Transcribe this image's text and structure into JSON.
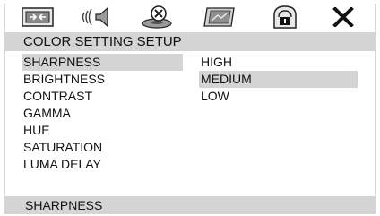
{
  "toolbar": {
    "icons": [
      "general-setup-icon",
      "audio-setup-icon",
      "dolby-digital-setup-icon",
      "video-setup-icon",
      "preference-lock-icon",
      "exit-icon"
    ]
  },
  "header": {
    "title": "COLOR SETTING SETUP"
  },
  "settings": {
    "items": [
      {
        "label": "SHARPNESS",
        "selected": true
      },
      {
        "label": "BRIGHTNESS",
        "selected": false
      },
      {
        "label": "CONTRAST",
        "selected": false
      },
      {
        "label": "GAMMA",
        "selected": false
      },
      {
        "label": "HUE",
        "selected": false
      },
      {
        "label": "SATURATION",
        "selected": false
      },
      {
        "label": "LUMA DELAY",
        "selected": false
      }
    ]
  },
  "options": {
    "items": [
      {
        "label": "HIGH",
        "selected": false
      },
      {
        "label": "MEDIUM",
        "selected": true
      },
      {
        "label": "LOW",
        "selected": false
      }
    ]
  },
  "footer": {
    "status": "SHARPNESS"
  },
  "colors": {
    "highlight": "#d4d4d4",
    "background": "#ffffff",
    "text": "#111111"
  }
}
